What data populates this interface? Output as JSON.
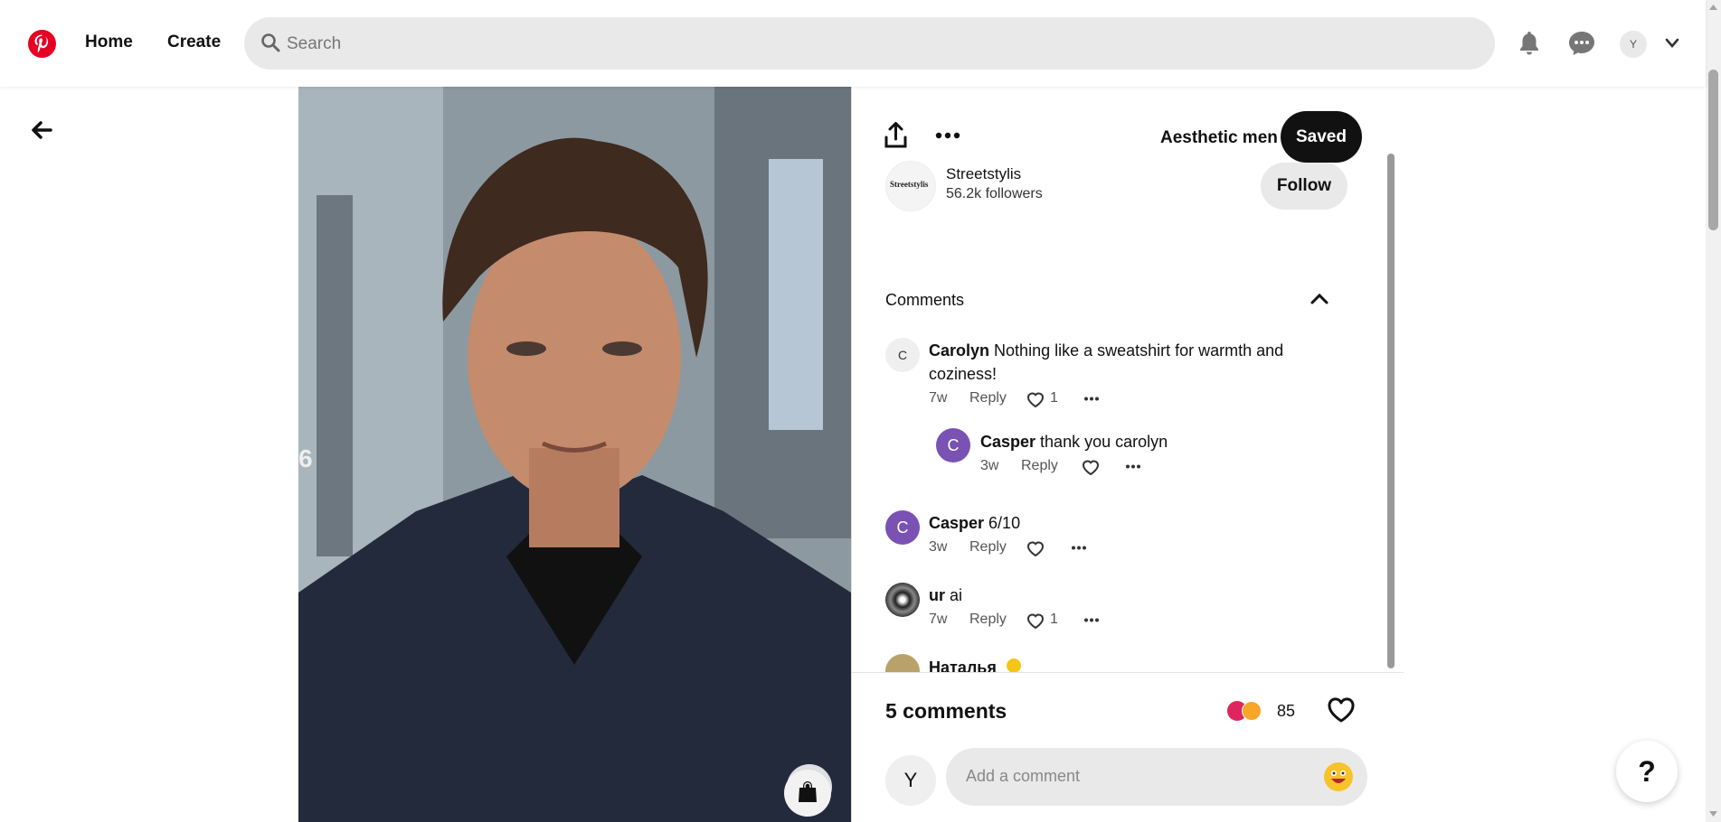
{
  "header": {
    "nav": {
      "home": "Home",
      "create": "Create"
    },
    "search_placeholder": "Search",
    "user_initial": "Y"
  },
  "pin": {
    "board_name": "Aesthetic men",
    "saved_label": "Saved",
    "creator": {
      "name": "Streetstylis",
      "followers": "56.2k followers",
      "logo_text": "Streetstylis"
    },
    "follow_label": "Follow",
    "image_overlay_char": "6",
    "comments_header": "Comments",
    "comments": [
      {
        "initial": "C",
        "author": "Carolyn",
        "text": "Nothing like a sweatshirt for warmth and",
        "text2": "coziness!",
        "age": "7w",
        "reply": "Reply",
        "likes": "1"
      },
      {
        "initial": "C",
        "author": "Casper",
        "text": "thank you carolyn",
        "age": "3w",
        "reply": "Reply",
        "likes": ""
      },
      {
        "initial": "C",
        "author": "Casper",
        "text": "6/10",
        "age": "3w",
        "reply": "Reply",
        "likes": ""
      },
      {
        "initial": "",
        "author": "ur",
        "text": "ai",
        "age": "7w",
        "reply": "Reply",
        "likes": "1"
      },
      {
        "initial": "",
        "author": "Наталья",
        "text": "",
        "age": "",
        "reply": "",
        "likes": ""
      }
    ],
    "comment_count": "5 comments",
    "reaction_count": "85",
    "add_comment_placeholder": "Add a comment",
    "user_initial": "Y"
  },
  "help_label": "?",
  "colors": {
    "brand": "#e60023",
    "purple_avatar": "#7952b3",
    "dark": "#111111"
  }
}
